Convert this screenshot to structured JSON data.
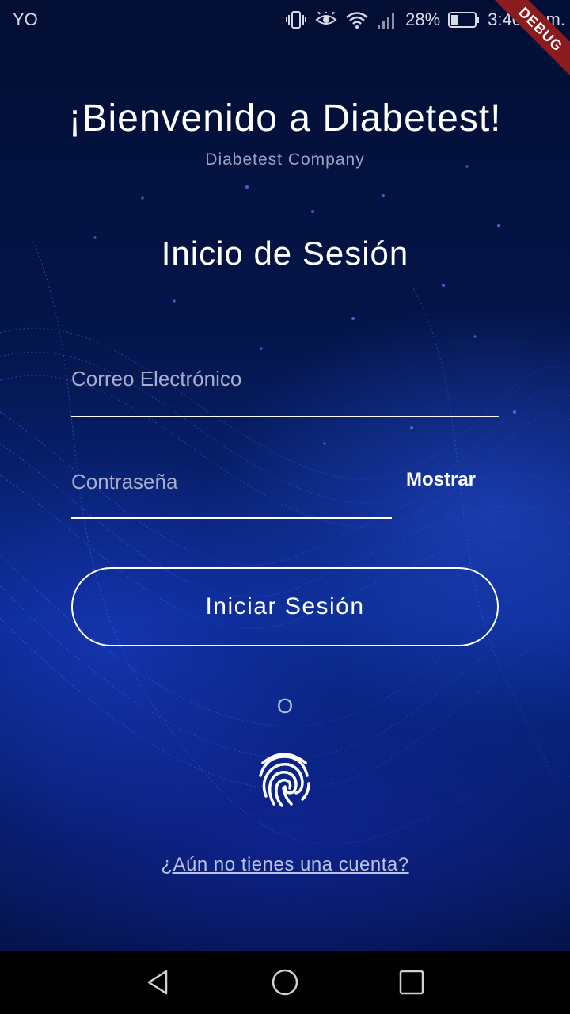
{
  "status_bar": {
    "carrier": "YO",
    "battery": "28%",
    "time": "3:40 p. m.",
    "debug_label": "DEBUG"
  },
  "header": {
    "title": "¡Bienvenido a Diabetest!",
    "subtitle": "Diabetest Company"
  },
  "login": {
    "section_title": "Inicio de Sesión",
    "email_placeholder": "Correo Electrónico",
    "password_placeholder": "Contraseña",
    "show_password_label": "Mostrar",
    "submit_label": "Iniciar Sesión",
    "or_label": "O",
    "signup_link": "¿Aún no tienes una cuenta?"
  },
  "icons": {
    "fingerprint": "fingerprint-icon",
    "back": "back-icon",
    "home": "home-icon",
    "recents": "recents-icon"
  },
  "colors": {
    "background_top": "#020e33",
    "background_mid": "#0a2a8e",
    "debug_banner": "#8b1b1e"
  }
}
